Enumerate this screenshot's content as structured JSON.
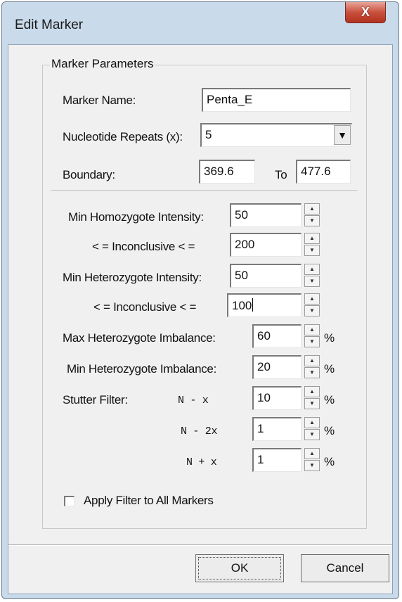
{
  "window": {
    "title": "Edit Marker",
    "close_glyph": "X"
  },
  "group": {
    "label": "Marker Parameters"
  },
  "marker_name": {
    "label": "Marker Name:",
    "value": "Penta_E"
  },
  "nucleotide_repeats": {
    "label": "Nucleotide Repeats (x):",
    "value": "5"
  },
  "boundary": {
    "label": "Boundary:",
    "from": "369.6",
    "to_label": "To",
    "to": "477.6"
  },
  "min_homozygote": {
    "label": "Min Homozygote Intensity:",
    "value": "50"
  },
  "homo_inconclusive": {
    "label": "< =  Inconclusive  < =",
    "value": "200"
  },
  "min_heterozygote": {
    "label": "Min Heterozygote Intensity:",
    "value": "50"
  },
  "hetero_inconclusive": {
    "label": "< =  Inconclusive  < =",
    "value": "100"
  },
  "max_imbalance": {
    "label": "Max Heterozygote Imbalance:",
    "value": "60",
    "unit": "%"
  },
  "min_imbalance": {
    "label": "Min Heterozygote Imbalance:",
    "value": "20",
    "unit": "%"
  },
  "stutter": {
    "label": "Stutter Filter:",
    "rows": [
      {
        "expr": "N - x",
        "value": "10",
        "unit": "%"
      },
      {
        "expr": "N - 2x",
        "value": "1",
        "unit": "%"
      },
      {
        "expr": "N + x",
        "value": "1",
        "unit": "%"
      }
    ]
  },
  "apply_all": {
    "label": "Apply Filter to All Markers",
    "checked": false
  },
  "buttons": {
    "ok": "OK",
    "cancel": "Cancel"
  },
  "icons": {
    "dropdown": "chevron-down-icon",
    "spin_up": "triangle-up-icon",
    "spin_down": "triangle-down-icon"
  }
}
